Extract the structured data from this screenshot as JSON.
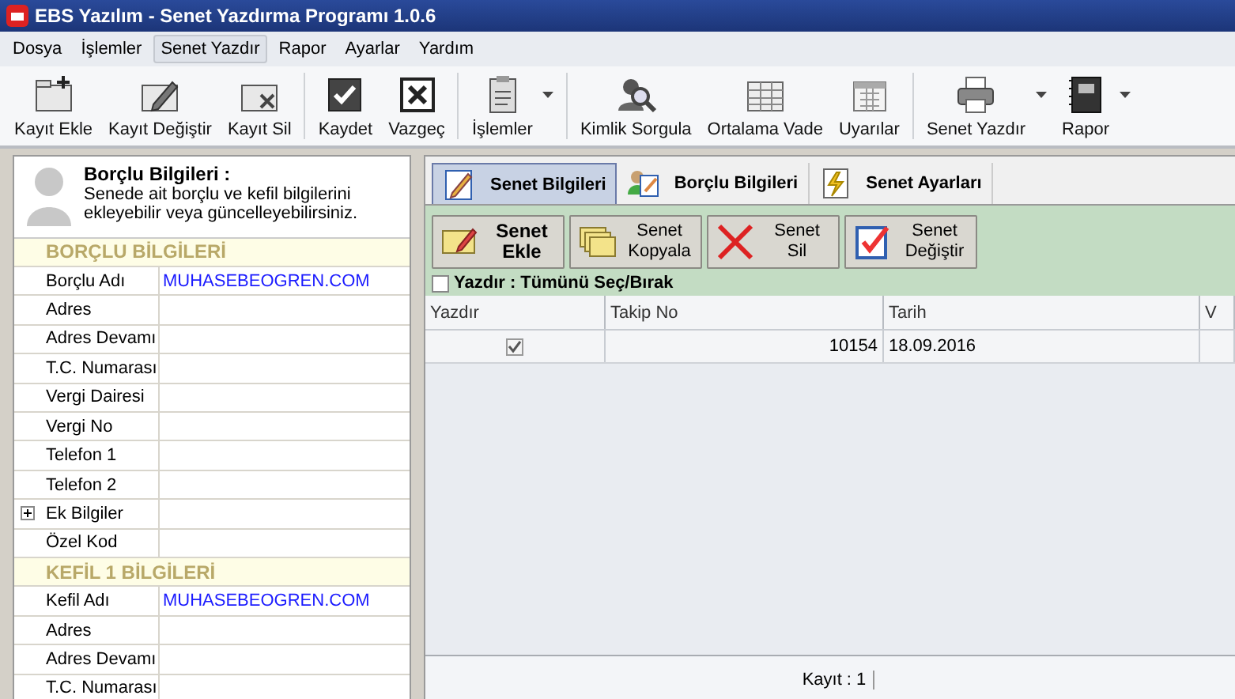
{
  "window": {
    "title": "EBS Yazılım - Senet Yazdırma Programı 1.0.6"
  },
  "menu": [
    {
      "label": "Dosya",
      "selected": false
    },
    {
      "label": "İşlemler",
      "selected": false
    },
    {
      "label": "Senet Yazdır",
      "selected": true
    },
    {
      "label": "Rapor",
      "selected": false
    },
    {
      "label": "Ayarlar",
      "selected": false
    },
    {
      "label": "Yardım",
      "selected": false
    }
  ],
  "toolbar": [
    {
      "label": "Kayıt Ekle",
      "dropdown": false,
      "separator_before": false
    },
    {
      "label": "Kayıt Değiştir",
      "dropdown": false,
      "separator_before": false
    },
    {
      "label": "Kayıt Sil",
      "dropdown": false,
      "separator_before": false
    },
    {
      "label": "Kaydet",
      "dropdown": false,
      "separator_before": true
    },
    {
      "label": "Vazgeç",
      "dropdown": false,
      "separator_before": false
    },
    {
      "label": "İşlemler",
      "dropdown": true,
      "separator_before": true
    },
    {
      "label": "Kimlik Sorgula",
      "dropdown": false,
      "separator_before": true
    },
    {
      "label": "Ortalama Vade",
      "dropdown": false,
      "separator_before": false
    },
    {
      "label": "Uyarılar",
      "dropdown": false,
      "separator_before": false
    },
    {
      "label": "Senet Yazdır",
      "dropdown": true,
      "separator_before": true
    },
    {
      "label": "Rapor",
      "dropdown": true,
      "separator_before": false
    }
  ],
  "left_panel": {
    "title": "Borçlu Bilgileri :",
    "description": "Senede ait borçlu ve kefil bilgilerini ekleyebilir veya güncelleyebilirsiniz.",
    "rows": [
      {
        "kind": "section",
        "label": "BORÇLU BİLGİLERİ"
      },
      {
        "kind": "field",
        "label": "Borçlu Adı",
        "value": "MUHASEBEOGREN.COM"
      },
      {
        "kind": "field",
        "label": "Adres"
      },
      {
        "kind": "field",
        "label": "Adres Devamı"
      },
      {
        "kind": "field",
        "label": "T.C. Numarası"
      },
      {
        "kind": "field",
        "label": "Vergi Dairesi"
      },
      {
        "kind": "field",
        "label": "Vergi No"
      },
      {
        "kind": "field",
        "label": "Telefon 1"
      },
      {
        "kind": "field",
        "label": "Telefon 2"
      },
      {
        "kind": "group",
        "label": "Ek Bilgiler",
        "expanded": false
      },
      {
        "kind": "field",
        "label": "Özel Kod"
      },
      {
        "kind": "section",
        "label": "KEFİL 1 BİLGİLERİ"
      },
      {
        "kind": "field",
        "label": "Kefil Adı",
        "value": "MUHASEBEOGREN.COM"
      },
      {
        "kind": "field",
        "label": "Adres"
      },
      {
        "kind": "field",
        "label": "Adres Devamı"
      },
      {
        "kind": "field",
        "label": "T.C. Numarası"
      }
    ]
  },
  "tabs": [
    {
      "label": "Senet Bilgileri",
      "selected": true
    },
    {
      "label": "Borçlu Bilgileri",
      "selected": false
    },
    {
      "label": "Senet Ayarları",
      "selected": false
    }
  ],
  "actions": [
    {
      "label": "Senet Ekle",
      "bold": true
    },
    {
      "label": "Senet Kopyala",
      "bold": false
    },
    {
      "label": "Senet Sil",
      "bold": false
    },
    {
      "label": "Senet Değiştir",
      "bold": false
    }
  ],
  "select_all": {
    "label": "Yazdır : Tümünü Seç/Bırak",
    "checked": false
  },
  "table": {
    "columns": [
      "Yazdır",
      "Takip No",
      "Tarih",
      "V"
    ],
    "rows": [
      {
        "checked": true,
        "takip_no": "10154",
        "tarih": "18.09.2016"
      }
    ]
  },
  "status_bar": {
    "text": "Kayıt : 1"
  }
}
